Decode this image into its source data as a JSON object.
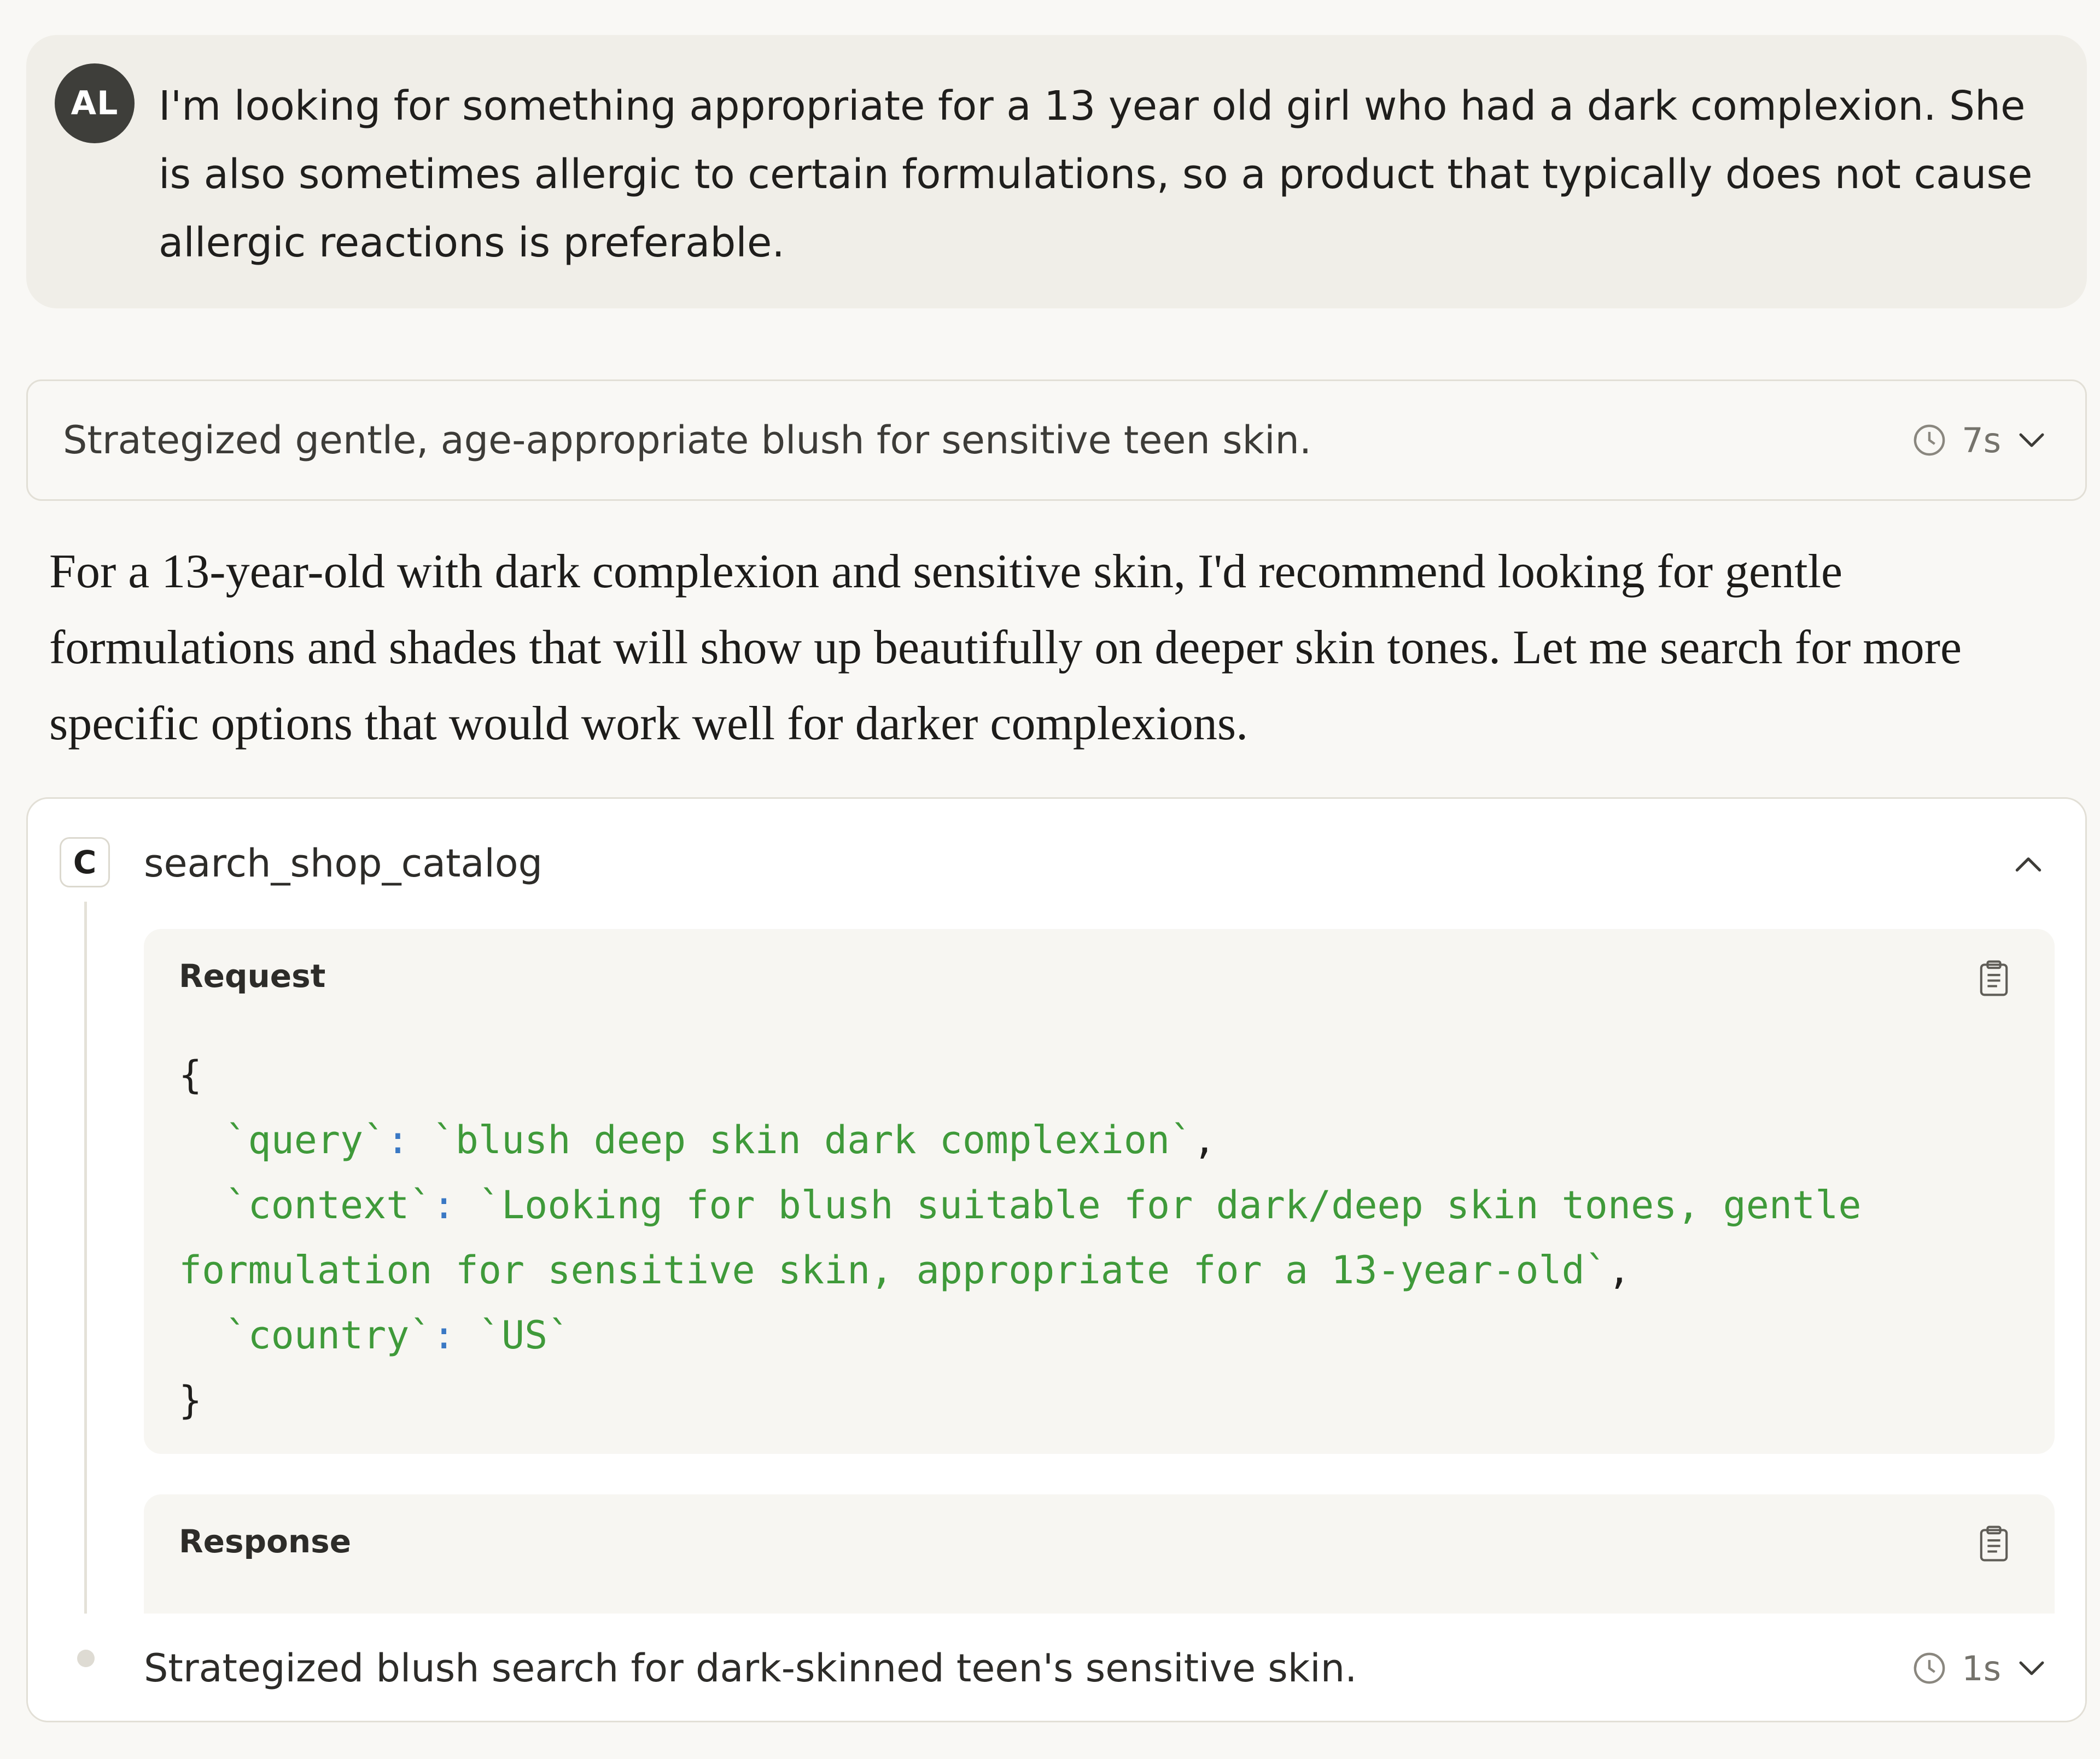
{
  "user_message": {
    "avatar_initials": "AL",
    "text": "I'm looking for something appropriate for a 13 year old girl who had a dark complexion. She is also sometimes allergic to certain formulations, so a product that typically does not cause allergic reactions is preferable."
  },
  "thinking_summary": {
    "text": "Strategized gentle, age-appropriate blush for sensitive teen skin.",
    "duration": "7s",
    "clock_icon": "clock-icon",
    "toggle_icon": "chevron-down-icon"
  },
  "assistant_reply": {
    "text": "For a 13-year-old with dark complexion and sensitive skin, I'd recommend looking for gentle formulations and shades that will show up beautifully on deeper skin tones. Let me search for more specific options that would work well for darker complexions."
  },
  "tool_call": {
    "icon_letter": "C",
    "name": "search_shop_catalog",
    "collapse_icon": "chevron-up-icon",
    "request": {
      "title": "Request",
      "open_brace": "{",
      "close_brace": "}",
      "params": [
        {
          "key": "`query`",
          "value": "`blush deep skin dark complexion`",
          "trailing": ","
        },
        {
          "key": "`context`",
          "value": "`Looking for blush suitable for dark/deep skin tones, gentle formulation for sensitive skin, appropriate for a 13-year-old`",
          "trailing": ","
        },
        {
          "key": "`country`",
          "value": "`US`",
          "trailing": ""
        }
      ],
      "copy_icon": "clipboard-icon"
    },
    "response": {
      "title": "Response",
      "copy_icon": "clipboard-icon"
    }
  },
  "followup_thinking": {
    "text": "Strategized blush search for dark-skinned teen's sensitive skin.",
    "duration": "1s",
    "clock_icon": "clock-icon",
    "toggle_icon": "chevron-down-icon"
  },
  "colors": {
    "background": "#f9f8f5",
    "user_bubble": "#f0eee8",
    "avatar": "#3e3e3a",
    "code_string": "#3f9a3a",
    "code_colon": "#3a78c4"
  }
}
